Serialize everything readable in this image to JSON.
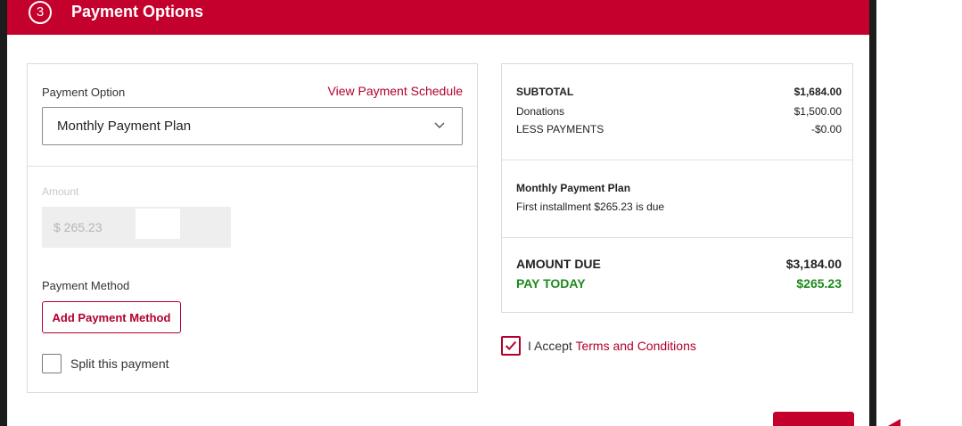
{
  "header": {
    "step": "3",
    "title": "Payment Options"
  },
  "payment_option": {
    "label": "Payment Option",
    "schedule_link": "View Payment Schedule",
    "selected": "Monthly Payment Plan"
  },
  "amount": {
    "label": "Amount",
    "value": "$ 265.23"
  },
  "payment_method": {
    "label": "Payment Method",
    "add_button": "Add Payment Method",
    "split_label": "Split this payment",
    "split_checked": false
  },
  "summary": {
    "subtotal_label": "SUBTOTAL",
    "subtotal_value": "$1,684.00",
    "donations_label": "Donations",
    "donations_value": "$1,500.00",
    "less_payments_label": "LESS PAYMENTS",
    "less_payments_value": "-$0.00",
    "plan_title": "Monthly Payment Plan",
    "plan_note": "First installment $265.23 is due",
    "amount_due_label": "AMOUNT DUE",
    "amount_due_value": "$3,184.00",
    "pay_today_label": "PAY TODAY",
    "pay_today_value": "$265.23"
  },
  "terms": {
    "prefix": "I Accept",
    "link": "Terms and Conditions",
    "checked": true
  },
  "colors": {
    "brand_red": "#c4002c",
    "link_red": "#b1002b",
    "pay_today_green": "#1c8a1c"
  }
}
